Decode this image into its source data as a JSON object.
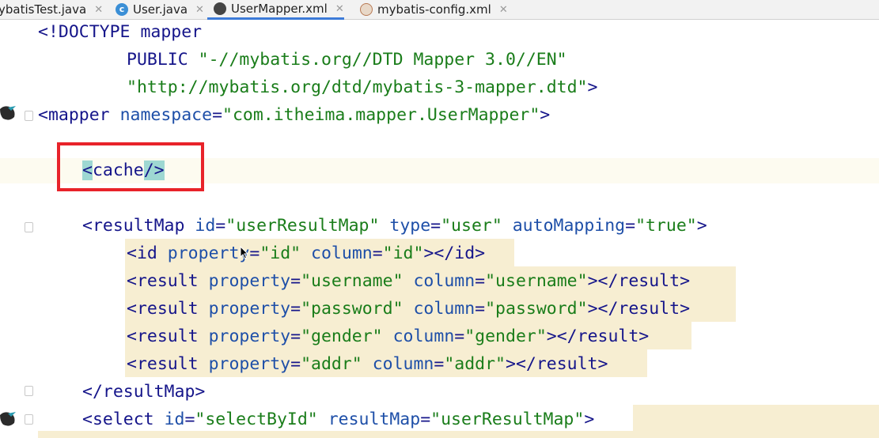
{
  "tabs": [
    {
      "label": "ybatisTest.java",
      "icon": "java-class-icon"
    },
    {
      "label": "User.java",
      "icon": "java-class-icon"
    },
    {
      "label": "UserMapper.xml",
      "icon": "mybatis-bird-icon",
      "active": true
    },
    {
      "label": "mybatis-config.xml",
      "icon": "xml-file-icon"
    }
  ],
  "close_glyph": "✕",
  "code": {
    "doctype_open": "<!DOCTYPE ",
    "doctype_name": "mapper",
    "public_kw": "PUBLIC",
    "public_id": "\"-//mybatis.org//DTD Mapper 3.0//EN\"",
    "system_id": "\"http://mybatis.org/dtd/mybatis-3-mapper.dtd\"",
    "doctype_close": ">",
    "mapper_tag": "<mapper",
    "namespace_attr": "namespace",
    "namespace_val": "\"com.itheima.mapper.UserMapper\"",
    "cache_open": "<",
    "cache_name": "cache",
    "cache_close": "/>",
    "resultmap_tag": "<resultMap",
    "rm_id_attr": "id",
    "rm_id_val": "\"userResultMap\"",
    "rm_type_attr": "type",
    "rm_type_val": "\"user\"",
    "rm_auto_attr": "autoMapping",
    "rm_auto_val": "\"true\"",
    "id_tag": "<id",
    "id_close": "</id>",
    "result_tag": "<result",
    "result_close": "</result>",
    "property_attr": "property",
    "column_attr": "column",
    "id_prop": "\"id\"",
    "id_col": "\"id\"",
    "r1_prop": "\"username\"",
    "r1_col": "\"username\"",
    "r2_prop": "\"password\"",
    "r2_col": "\"password\"",
    "r3_prop": "\"gender\"",
    "r3_col": "\"gender\"",
    "r4_prop": "\"addr\"",
    "r4_col": "\"addr\"",
    "resultmap_close": "</resultMap>",
    "select_tag": "<select",
    "sel_id_attr": "id",
    "sel_id_val": "\"selectById\"",
    "sel_rm_attr": "resultMap",
    "sel_rm_val": "\"userResultMap\"",
    "eq": "=",
    "gt": ">",
    "space": " "
  },
  "colors": {
    "tag": "#15158a",
    "attribute": "#1e4fa8",
    "string": "#1a7d1a",
    "highlight_box": "#e8232a",
    "brace_match": "#9ed8d2",
    "injected_bg": "#f7eed2"
  }
}
